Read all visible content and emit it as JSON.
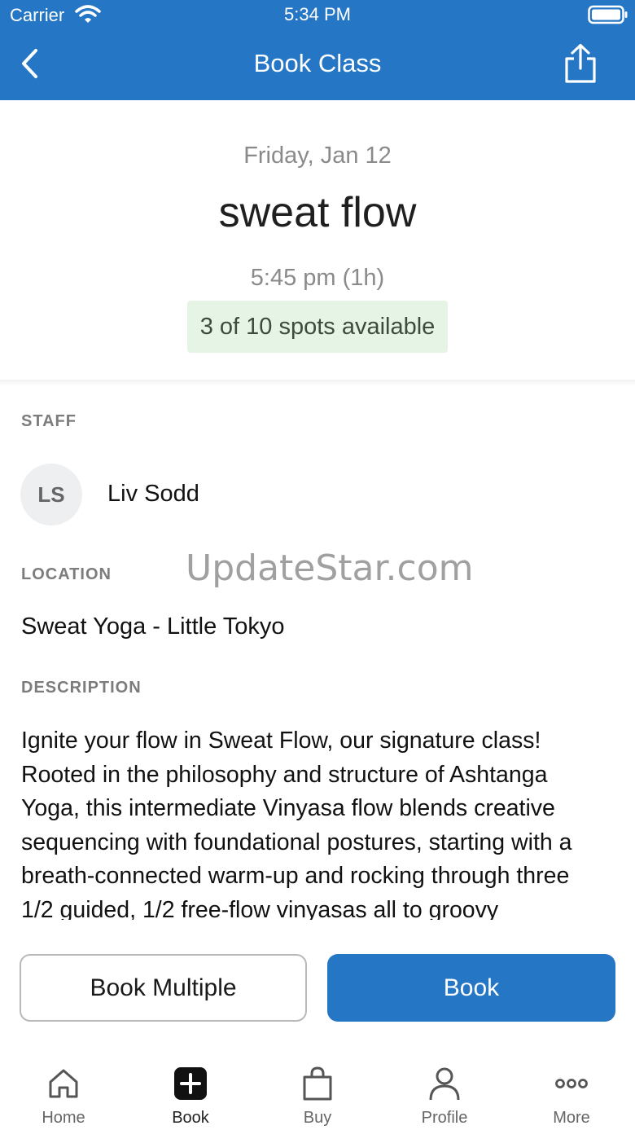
{
  "status_bar": {
    "carrier": "Carrier",
    "time": "5:34 PM"
  },
  "nav": {
    "title": "Book Class"
  },
  "class": {
    "date": "Friday, Jan 12",
    "name": "sweat flow",
    "time": "5:45 pm (1h)",
    "spots": "3 of 10 spots available"
  },
  "staff": {
    "label": "STAFF",
    "initials": "LS",
    "name": "Liv Sodd"
  },
  "location": {
    "label": "LOCATION",
    "name": "Sweat Yoga - Little Tokyo"
  },
  "watermark": "UpdateStar.com",
  "description": {
    "label": "DESCRIPTION",
    "text": "Ignite your flow in Sweat Flow, our signature class! Rooted in the philosophy and structure of Ashtanga Yoga, this intermediate Vinyasa flow blends creative sequencing with foundational postures, starting with a breath-connected warm-up and rocking through three 1/2 guided, 1/2 free-flow vinyasas all to groovy"
  },
  "actions": {
    "book_multiple": "Book Multiple",
    "book": "Book"
  },
  "tabs": [
    {
      "label": "Home",
      "icon": "home-icon"
    },
    {
      "label": "Book",
      "icon": "plus-icon"
    },
    {
      "label": "Buy",
      "icon": "bag-icon"
    },
    {
      "label": "Profile",
      "icon": "person-icon"
    },
    {
      "label": "More",
      "icon": "more-icon"
    }
  ],
  "colors": {
    "primary": "#2577c6",
    "spots_bg": "#e5f4e4"
  }
}
